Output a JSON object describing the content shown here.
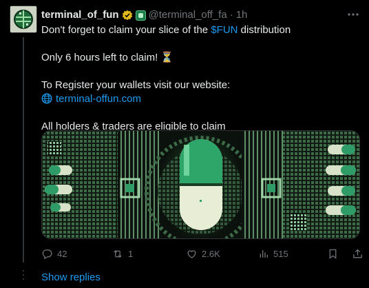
{
  "post": {
    "author_name": "terminal_of_fun",
    "handle": "@terminal_off_fa",
    "separator": "·",
    "time": "1h",
    "text": {
      "line1_prefix": "Don't forget to claim your slice of the ",
      "line1_cashtag": "$FUN",
      "line1_suffix": " distribution",
      "line2": "Only 6 hours left to claim! ⏳",
      "line3": "To Register your wallets visit our website:",
      "line4_link": "terminal-offun.com",
      "line5": "All holders & traders are eligible to claim"
    },
    "icons": {
      "verified": "gold-checkmark-badge-icon",
      "affiliate": "green-app-badge-icon",
      "more": "more-dots-icon",
      "globe": "globe-icon",
      "media": "pixel-art-pill-capsule-image"
    }
  },
  "actions": {
    "replies": "42",
    "reposts": "1",
    "likes": "2.6K",
    "views": "515"
  },
  "footer": {
    "show_replies": "Show replies"
  },
  "colors": {
    "background": "#000000",
    "text": "#e7e9ea",
    "muted": "#71767b",
    "accent": "#1d9bf0",
    "badge_gold": "#e2b719"
  }
}
